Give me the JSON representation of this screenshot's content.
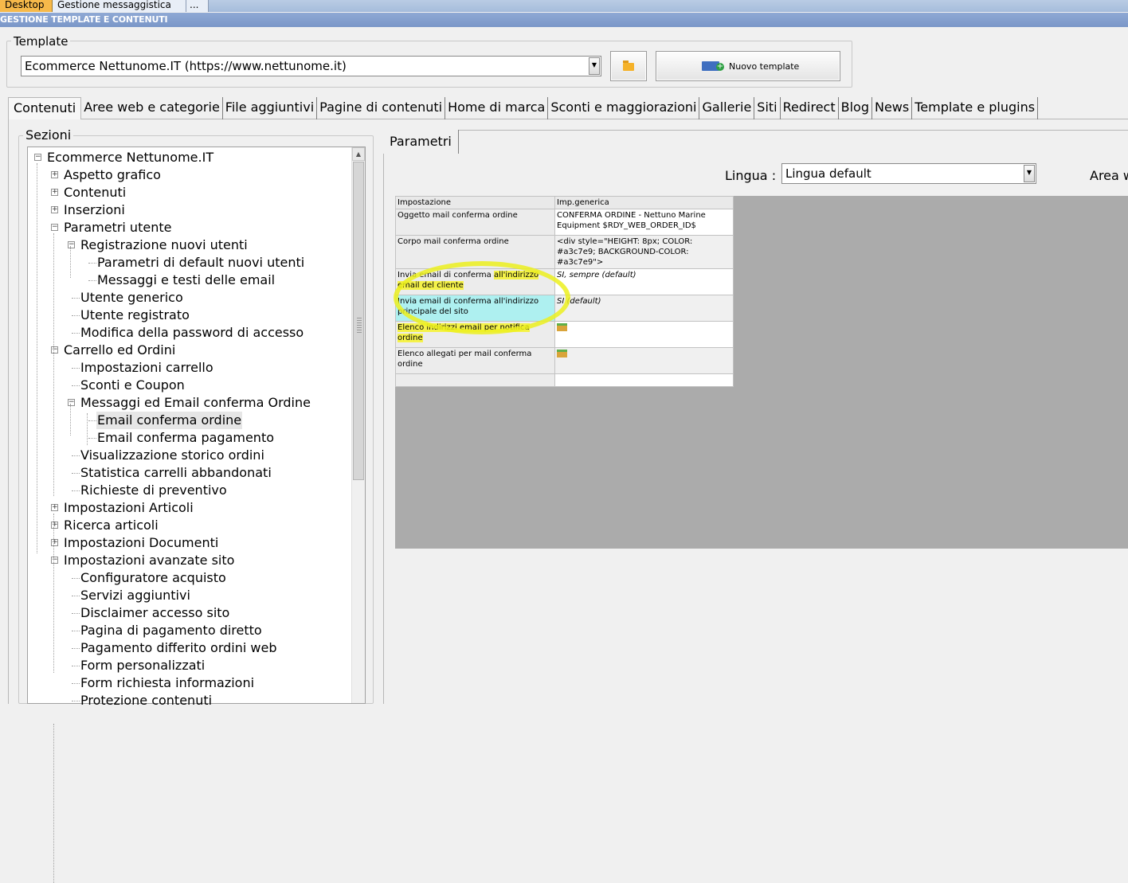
{
  "window_tabs": [
    "Desktop",
    "Gestione messaggistica",
    "..."
  ],
  "section_title": "GESTIONE TEMPLATE E CONTENUTI",
  "template_group": {
    "legend": "Template",
    "selected": "Ecommerce Nettunome.IT (https://www.nettunome.it)",
    "new_button_label": "Nuovo template"
  },
  "main_tabs": [
    "Contenuti",
    "Aree web e categorie",
    "File aggiuntivi",
    "Pagine di contenuti",
    "Home di marca",
    "Sconti e maggiorazioni",
    "Gallerie",
    "Siti",
    "Redirect",
    "Blog",
    "News",
    "Template e plugins"
  ],
  "sections": {
    "legend": "Sezioni",
    "tree": [
      {
        "label": "Ecommerce Nettunome.IT",
        "level": 0,
        "expander": "-"
      },
      {
        "label": "Aspetto grafico",
        "level": 1,
        "expander": "+"
      },
      {
        "label": "Contenuti",
        "level": 1,
        "expander": "+"
      },
      {
        "label": "Inserzioni",
        "level": 1,
        "expander": "+"
      },
      {
        "label": "Parametri utente",
        "level": 1,
        "expander": "-"
      },
      {
        "label": "Registrazione nuovi utenti",
        "level": 2,
        "expander": "-"
      },
      {
        "label": "Parametri di default nuovi utenti",
        "level": 3,
        "expander": ""
      },
      {
        "label": "Messaggi e testi delle email",
        "level": 3,
        "expander": ""
      },
      {
        "label": "Utente generico",
        "level": 2,
        "expander": ""
      },
      {
        "label": "Utente registrato",
        "level": 2,
        "expander": ""
      },
      {
        "label": "Modifica della password di accesso",
        "level": 2,
        "expander": ""
      },
      {
        "label": "Carrello ed Ordini",
        "level": 1,
        "expander": "-"
      },
      {
        "label": "Impostazioni carrello",
        "level": 2,
        "expander": ""
      },
      {
        "label": "Sconti e Coupon",
        "level": 2,
        "expander": ""
      },
      {
        "label": "Messaggi ed Email conferma Ordine",
        "level": 2,
        "expander": "-"
      },
      {
        "label": "Email conferma ordine",
        "level": 3,
        "expander": "",
        "selected": true
      },
      {
        "label": "Email conferma pagamento",
        "level": 3,
        "expander": ""
      },
      {
        "label": "Visualizzazione storico ordini",
        "level": 2,
        "expander": ""
      },
      {
        "label": "Statistica carrelli abbandonati",
        "level": 2,
        "expander": ""
      },
      {
        "label": "Richieste di preventivo",
        "level": 2,
        "expander": ""
      },
      {
        "label": "Impostazioni Articoli",
        "level": 1,
        "expander": "+"
      },
      {
        "label": "Ricerca articoli",
        "level": 1,
        "expander": "+"
      },
      {
        "label": "Impostazioni Documenti",
        "level": 1,
        "expander": "+"
      },
      {
        "label": "Impostazioni avanzate sito",
        "level": 1,
        "expander": "-"
      },
      {
        "label": "Configuratore acquisto",
        "level": 2,
        "expander": ""
      },
      {
        "label": "Servizi aggiuntivi",
        "level": 2,
        "expander": ""
      },
      {
        "label": "Disclaimer accesso sito",
        "level": 2,
        "expander": ""
      },
      {
        "label": "Pagina di pagamento diretto",
        "level": 2,
        "expander": ""
      },
      {
        "label": "Pagamento differito ordini web",
        "level": 2,
        "expander": ""
      },
      {
        "label": "Form personalizzati",
        "level": 2,
        "expander": ""
      },
      {
        "label": "Form richiesta informazioni",
        "level": 2,
        "expander": ""
      },
      {
        "label": "Protezione contenuti",
        "level": 2,
        "expander": ""
      }
    ]
  },
  "params": {
    "tab": "Parametri",
    "lingua_label": "Lingua :",
    "lingua_value": "Lingua default",
    "area_label": "Area w",
    "columns": [
      "Impostazione",
      "Imp.generica"
    ],
    "rows": [
      {
        "key": "Oggetto mail conferma ordine",
        "value": "CONFERMA ORDINE - Nettuno Marine Equipment $RDY_WEB_ORDER_ID$"
      },
      {
        "key": "Corpo mail conferma ordine",
        "value": "<div style=\"HEIGHT: 8px; COLOR: #a3c7e9; BACKGROUND-COLOR: #a3c7e9\">"
      },
      {
        "key_parts": [
          "Invia email di conferma ",
          "all'indirizzo email del cliente"
        ],
        "value": "SI, sempre (default)"
      },
      {
        "key": "Invia email di conferma all'indirizzo principale del sito",
        "value": "SI (default)"
      },
      {
        "key_parts": [
          "",
          "Elenco indirizzi email per notifica ordine"
        ],
        "value": "folder-icon"
      },
      {
        "key": "Elenco allegati per mail conferma ordine",
        "value": "folder-icon"
      }
    ]
  },
  "colors": {
    "highlight": "#f5f24a",
    "selected_row": "#aef0f0",
    "accent_tab": "#f6b94a"
  }
}
